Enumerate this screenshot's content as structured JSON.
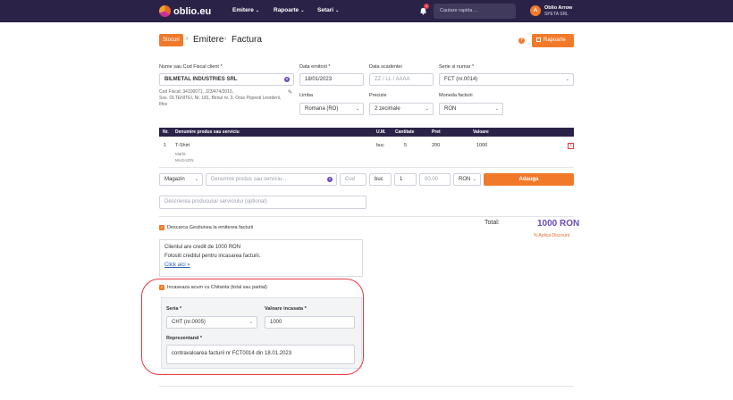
{
  "nav": {
    "logo_text": "oblio.eu",
    "items": [
      {
        "label": "Emitere"
      },
      {
        "label": "Rapoarte"
      },
      {
        "label": "Setari"
      }
    ],
    "notification_count": "1",
    "search_placeholder": "Cautare rapida ...",
    "user_initial": "A",
    "user_name": "Oblio Arrow",
    "user_company": "SPETA SRL"
  },
  "breadcrumb": {
    "badge": "Stocuri",
    "level1": "Emitere",
    "level2": "Factura"
  },
  "header_actions": {
    "help": "?",
    "rapoarte_label": "Rapoarte"
  },
  "client": {
    "label": "Nume sau Cod Fiscal client *",
    "value": "BILMETAL INDUSTRIES SRL",
    "details": [
      "Cod Fiscal: 34100071, J23/474/2015,",
      "Sos. OLTENITEI, Nr. 181, Biroul nr. 3, Oras Popesti Leordeni,",
      "Ilfov"
    ]
  },
  "invoice": {
    "date_label": "Data emitorii *",
    "date_value": "18/01/2023",
    "due_label": "Data scadentei",
    "due_placeholder": "ZZ / LL / AAAA",
    "series_label": "Serie si numar *",
    "series_value": "FCT (nr.0014)",
    "lang_label": "Limba",
    "lang_value": "Romana (RO)",
    "precision_label": "Precizie",
    "precision_value": "2 zecimale",
    "currency_label": "Moneda facturii",
    "currency_value": "RON"
  },
  "table": {
    "headers": [
      "Nr.",
      "Denumire produs sau serviciu",
      "U.M.",
      "Cantitate",
      "Pret",
      "Valoare"
    ],
    "rows": [
      {
        "nr": "1",
        "name": "T-Shirt",
        "sub1": "Marfa",
        "sub2": "MAGAZIN",
        "um": "buc",
        "qty": "5",
        "price": "200",
        "value": "1000"
      }
    ]
  },
  "add_row": {
    "warehouse": "Magazin",
    "product_placeholder": "Denumire produs sau serviciu...",
    "code_placeholder": "Cod",
    "um": "buc",
    "qty": "1",
    "price_placeholder": "00.00",
    "currency": "RON",
    "add_label": "Adauga",
    "description_placeholder": "Descrierea produsului/ serviciului (optional)"
  },
  "stock": {
    "label": "Descarca Gestiunea la emiterea facturii"
  },
  "totals": {
    "label": "Total:",
    "value": "1000 RON",
    "discount_label": "% Aplica Discount"
  },
  "credit": {
    "line1": "Clientul are credit de 1000 RON",
    "line2": "Folositi creditul pentru incasarea facturii.",
    "link": "Click aici »"
  },
  "payment": {
    "checkbox_label": "Incaseaza acum cu Chitanta (total sau partial)",
    "serie_label": "Seria *",
    "serie_value": "CHT (nr.0005)",
    "amount_label": "Valoare incasata *",
    "amount_value": "1000",
    "repr_label": "Reprezentand *",
    "repr_value": "contravaloarea facturii nr FCT0014 din 18.01.2023"
  }
}
